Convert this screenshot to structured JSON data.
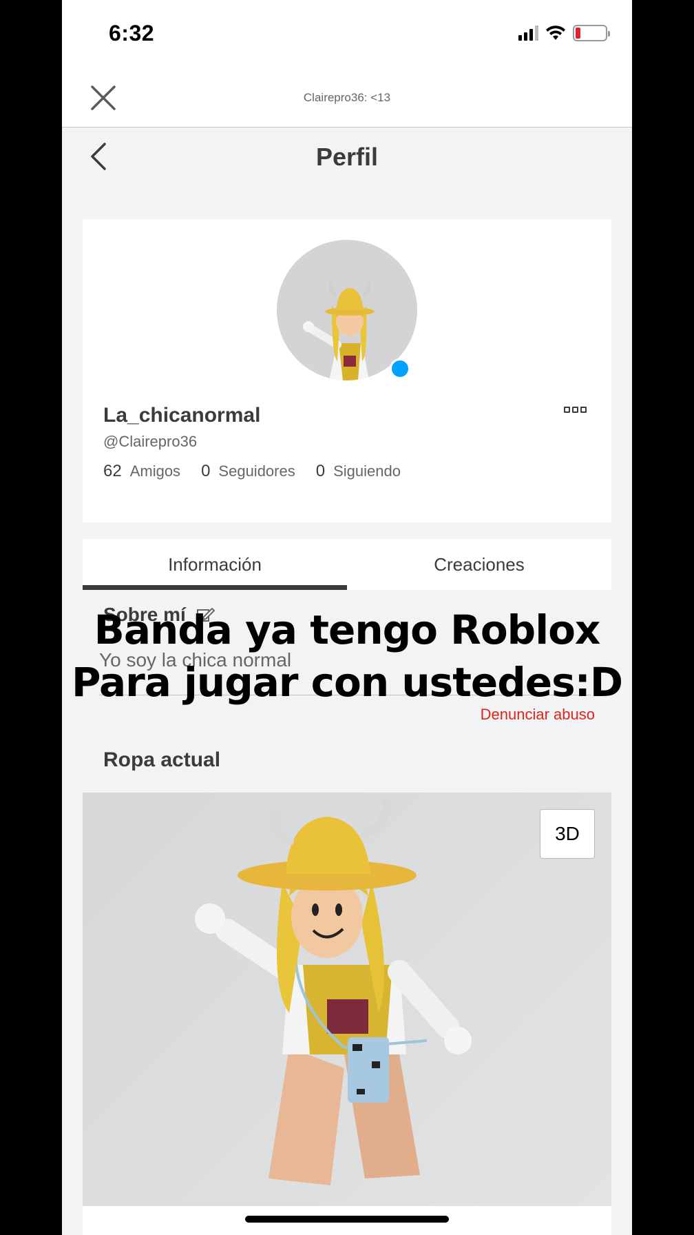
{
  "status_bar": {
    "time": "6:32",
    "battery_color": "#e0202a"
  },
  "top_bar": {
    "title": "Clairepro36: <13"
  },
  "nav": {
    "title": "Perfil"
  },
  "profile": {
    "display_name": "La_chicanormal",
    "username": "@Clairepro36",
    "online_color": "#00a2ff",
    "stats": [
      {
        "value": "62",
        "label": "Amigos"
      },
      {
        "value": "0",
        "label": "Seguidores"
      },
      {
        "value": "0",
        "label": "Siguiendo"
      }
    ]
  },
  "tabs": [
    {
      "label": "Información",
      "active": true
    },
    {
      "label": "Creaciones",
      "active": false
    }
  ],
  "about": {
    "title": "Sobre mí",
    "text": "Yo soy la chica normal",
    "report_label": "Denunciar abuso"
  },
  "overlay_caption": {
    "line1": "Banda ya tengo Roblox",
    "line2": "Para jugar con ustedes:D"
  },
  "outfit": {
    "title": "Ropa actual",
    "view_button": "3D"
  }
}
